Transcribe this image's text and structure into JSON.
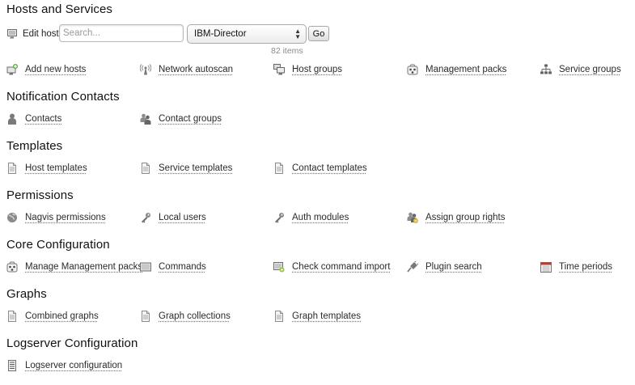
{
  "sections": {
    "hosts_services": "Hosts and Services",
    "notification_contacts": "Notification Contacts",
    "templates": "Templates",
    "permissions": "Permissions",
    "core_configuration": "Core Configuration",
    "graphs": "Graphs",
    "logserver_configuration": "Logserver Configuration"
  },
  "edit_host": {
    "label": "Edit host",
    "search_placeholder": "Search...",
    "selected_host": "IBM-Director",
    "go_label": "Go",
    "item_count": "82 items"
  },
  "links": {
    "add_new_hosts": "Add new hosts",
    "network_autoscan": "Network autoscan",
    "host_groups": "Host groups",
    "management_packs": "Management packs",
    "service_groups": "Service groups",
    "contacts": "Contacts",
    "contact_groups": "Contact groups",
    "host_templates": "Host templates",
    "service_templates": "Service templates",
    "contact_templates": "Contact templates",
    "nagvis_permissions": "Nagvis permissions",
    "local_users": "Local users",
    "auth_modules": "Auth modules",
    "assign_group_rights": "Assign group rights",
    "manage_management_packs": "Manage Management packs",
    "commands": "Commands",
    "check_command_import": "Check command import",
    "plugin_search": "Plugin search",
    "time_periods": "Time periods",
    "combined_graphs": "Combined graphs",
    "graph_collections": "Graph collections",
    "graph_templates": "Graph templates",
    "logserver_configuration": "Logserver configuration"
  }
}
